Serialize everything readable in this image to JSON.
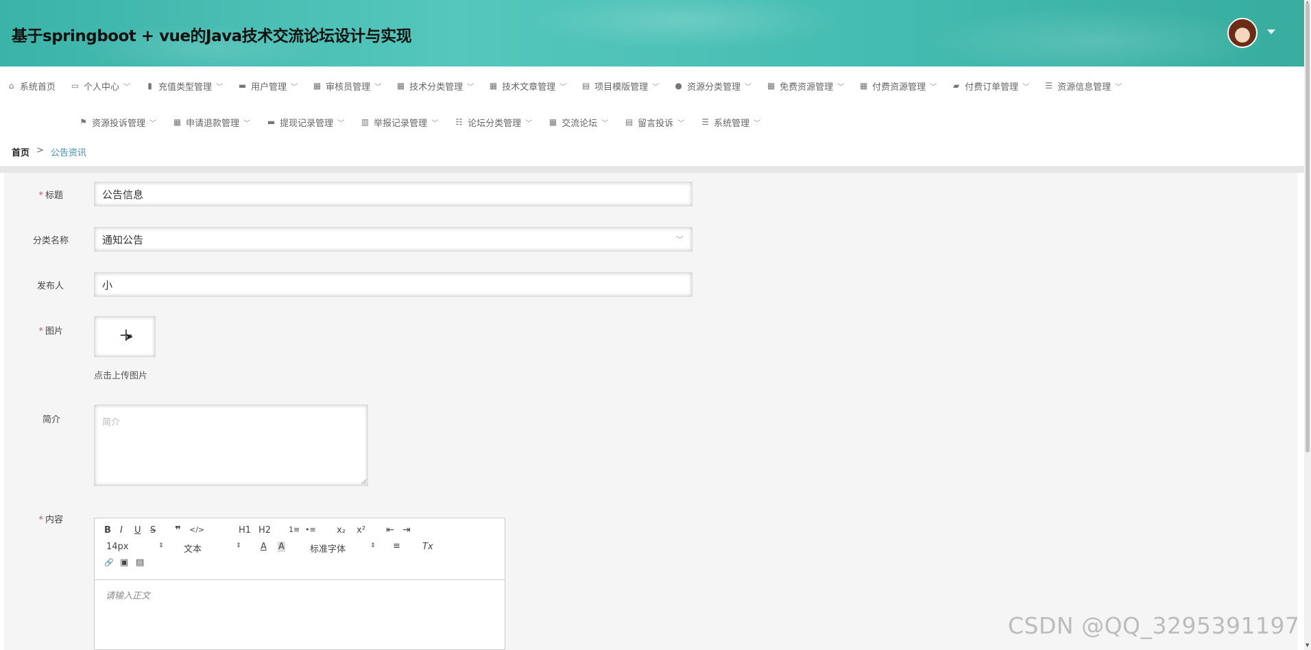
{
  "header": {
    "title": "基于springboot + vue的Java技术交流论坛设计与实现",
    "avatar_icon": "user-avatar",
    "caret_icon": "caret-down-icon"
  },
  "nav": {
    "row1": [
      {
        "label": "系统首页",
        "icon": "home-icon",
        "glyph": "⌂",
        "chevron": false
      },
      {
        "label": "个人中心",
        "icon": "id-card-icon",
        "glyph": "▭",
        "chevron": true
      },
      {
        "label": "充值类型管理",
        "icon": "book-icon",
        "glyph": "▮",
        "chevron": true
      },
      {
        "label": "用户管理",
        "icon": "briefcase-icon",
        "glyph": "▬",
        "chevron": true
      },
      {
        "label": "审核员管理",
        "icon": "grid-icon",
        "glyph": "▦",
        "chevron": true
      },
      {
        "label": "技术分类管理",
        "icon": "grid-icon",
        "glyph": "▦",
        "chevron": true
      },
      {
        "label": "技术文章管理",
        "icon": "grid-icon",
        "glyph": "▦",
        "chevron": true
      },
      {
        "label": "项目模版管理",
        "icon": "clipboard-icon",
        "glyph": "▤",
        "chevron": true
      },
      {
        "label": "资源分类管理",
        "icon": "location-icon",
        "glyph": "●",
        "chevron": true
      },
      {
        "label": "免费资源管理",
        "icon": "grid-icon",
        "glyph": "▦",
        "chevron": true
      },
      {
        "label": "付费资源管理",
        "icon": "grid-icon",
        "glyph": "▦",
        "chevron": true
      },
      {
        "label": "付费订单管理",
        "icon": "message-icon",
        "glyph": "▰",
        "chevron": true
      },
      {
        "label": "资源信息管理",
        "icon": "list-icon",
        "glyph": "☰",
        "chevron": true
      }
    ],
    "row2": [
      {
        "label": "资源投诉管理",
        "icon": "flag-icon",
        "glyph": "⚑",
        "chevron": true
      },
      {
        "label": "申请退款管理",
        "icon": "grid-icon",
        "glyph": "▦",
        "chevron": true
      },
      {
        "label": "提现记录管理",
        "icon": "printer-icon",
        "glyph": "▬",
        "chevron": true
      },
      {
        "label": "举报记录管理",
        "icon": "bar-chart-icon",
        "glyph": "▥",
        "chevron": true
      },
      {
        "label": "论坛分类管理",
        "icon": "sliders-icon",
        "glyph": "☷",
        "chevron": true
      },
      {
        "label": "交流论坛",
        "icon": "grid-icon",
        "glyph": "▦",
        "chevron": true
      },
      {
        "label": "留言投诉",
        "icon": "clipboard-check-icon",
        "glyph": "▤",
        "chevron": true
      },
      {
        "label": "系统管理",
        "icon": "list-icon",
        "glyph": "☰",
        "chevron": true
      }
    ],
    "chevron_glyph": "﹀"
  },
  "breadcrumb": {
    "home": "首页",
    "separator": ">",
    "current": "公告资讯"
  },
  "form": {
    "title_label": "标题",
    "title_value": "公告信息",
    "category_label": "分类名称",
    "category_value": "通知公告",
    "publisher_label": "发布人",
    "publisher_value": "小",
    "image_label": "图片",
    "upload_tip": "点击上传图片",
    "intro_label": "简介",
    "intro_placeholder": "简介",
    "content_label": "内容",
    "required_mark": "*"
  },
  "editor": {
    "buttons": {
      "bold": "B",
      "italic": "I",
      "underline": "U",
      "strike": "S",
      "blockquote": "❞",
      "code": "</>",
      "h1": "H1",
      "h2": "H2",
      "ordered_list": "1≡",
      "bullet_list": "•≡",
      "subscript": "x₂",
      "superscript": "x²",
      "outdent": "⇤",
      "indent": "⇥",
      "font_color": "A",
      "background": "A",
      "align": "≡",
      "clean": "Tx",
      "link": "🔗",
      "image": "▣",
      "video": "▤"
    },
    "size_select": "14px",
    "header_select": "文本",
    "font_select": "标准字体",
    "select_arrow": "⇕",
    "placeholder": "请输入正文"
  },
  "watermark": "CSDN @QQ_3295391197"
}
